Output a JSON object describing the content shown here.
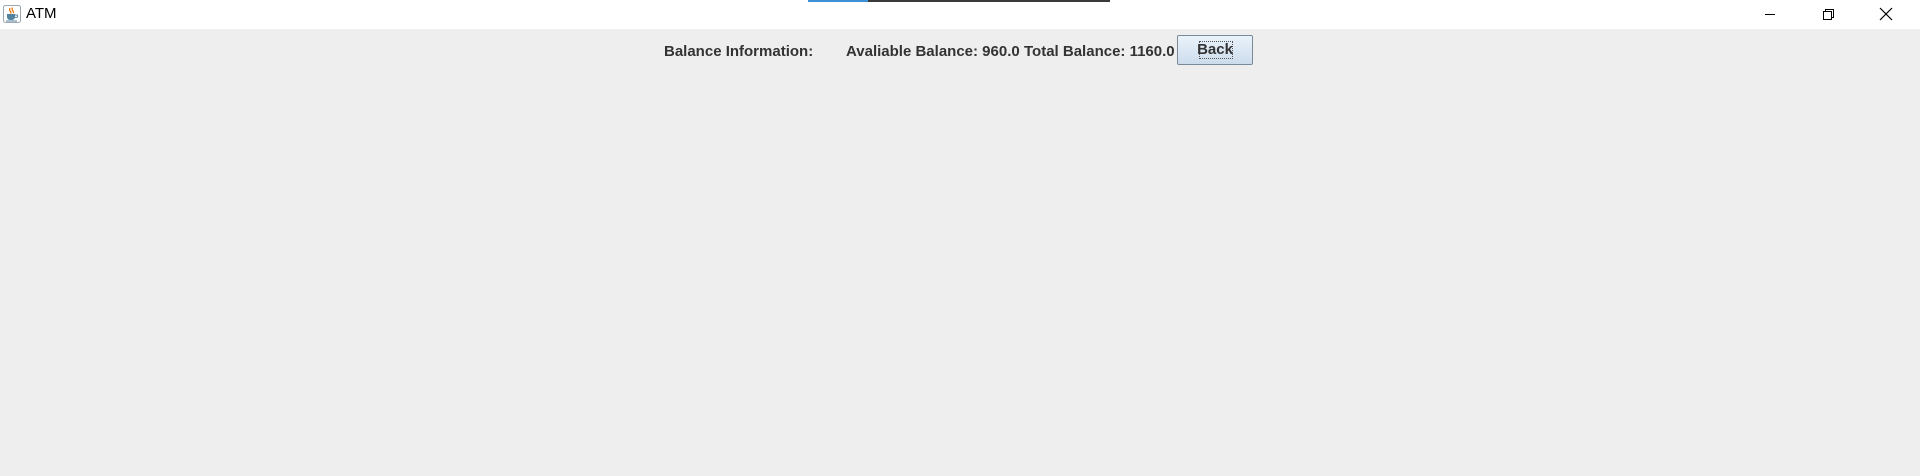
{
  "window": {
    "title": "ATM",
    "icon": "java-cup-icon",
    "controls": [
      "minimize-icon",
      "maximize-icon",
      "close-icon"
    ]
  },
  "balance": {
    "heading": "Balance Information:",
    "available": "Avaliable Balance: 960.0",
    "total": "Total Balance: 1160.0"
  },
  "buttons": {
    "back": "Back"
  }
}
